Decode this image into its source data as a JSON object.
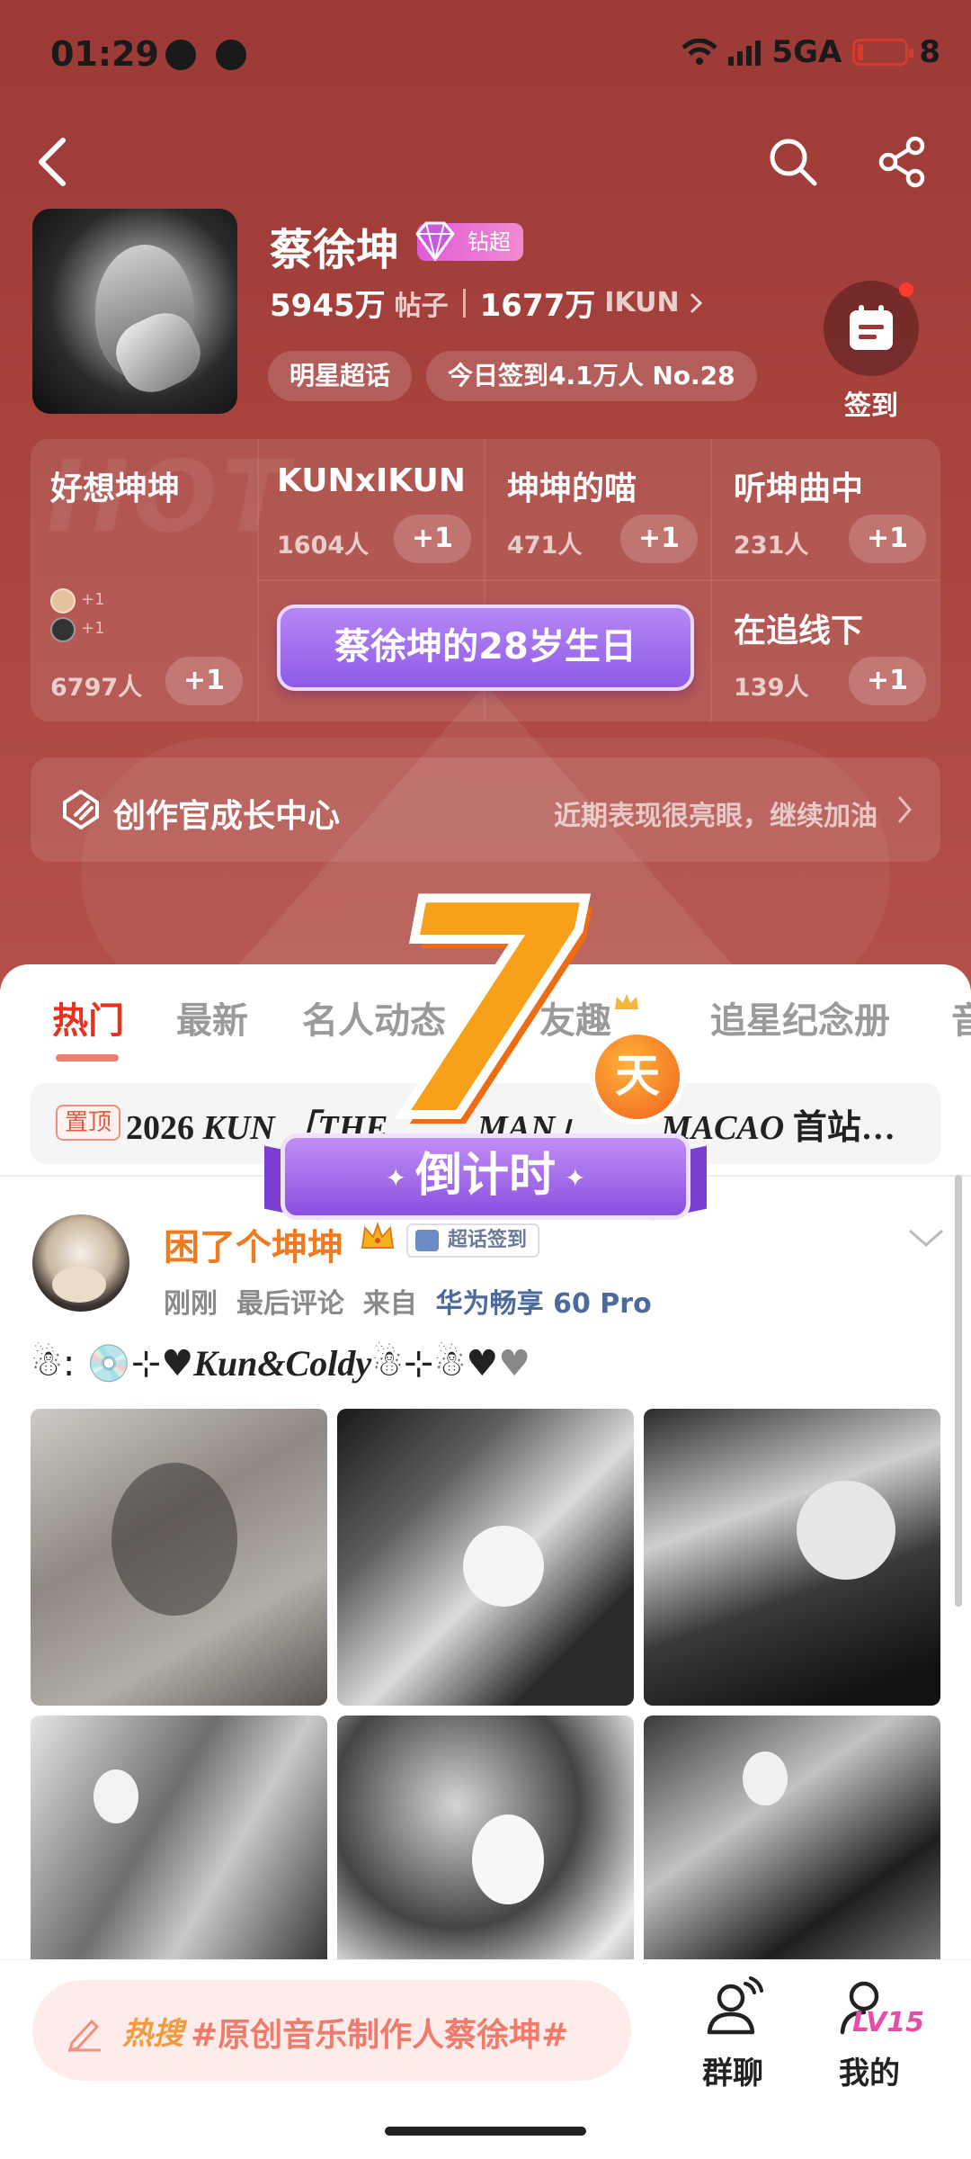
{
  "status_bar": {
    "time": "01:29",
    "network": "5GA",
    "battery": "8"
  },
  "profile": {
    "name": "蔡徐坤",
    "badge": "钻超",
    "posts_count": "5945万",
    "posts_label": "帖子",
    "fans_count": "1677万",
    "fans_label": "IKUN",
    "tags": [
      "明星超话",
      "今日签到4.1万人 No.28"
    ],
    "checkin_label": "签到"
  },
  "groups": [
    {
      "name": "好想坤坤",
      "count": "6797人",
      "join": "+1"
    },
    {
      "name": "KUNxIKUN",
      "count": "1604人",
      "join": "+1"
    },
    {
      "name": "坤坤的喵",
      "count": "471人",
      "join": "+1"
    },
    {
      "name": "听坤曲中",
      "count": "231人",
      "join": "+1"
    },
    {
      "name": "在追线下",
      "count": "139人",
      "join": "+1"
    }
  ],
  "groups_mini": [
    "+1",
    "+1"
  ],
  "birthday_banner": "蔡徐坤的28岁生日",
  "creator": {
    "title": "创作官成长中心",
    "subtitle": "近期表现很亮眼，继续加油"
  },
  "tabs": [
    "热门",
    "最新",
    "名人动态",
    "友趣",
    "追星纪念册",
    "音"
  ],
  "pinned": {
    "tag": "置顶",
    "year": "2026",
    "text_a": "KUN",
    "text_b": "「THE",
    "text_c": "MAN」",
    "text_d": "MACAO",
    "text_e": "首站…"
  },
  "countdown": {
    "number": "7",
    "unit": "天",
    "label": "倒计时"
  },
  "post": {
    "user": "困了个坤坤",
    "signin_badge": "超话签到",
    "time": "刚刚",
    "last_comment": "最后评论",
    "from": "来自",
    "device": "华为畅享 60 Pro",
    "content_script": "Kun&Coldy"
  },
  "bottom_bar": {
    "hot_tag": "热搜",
    "hot_text": "#原创音乐制作人蔡徐坤#",
    "group_chat": "群聊",
    "mine": "我的",
    "level": "LV15"
  },
  "colors": {
    "accent": "#e8321f",
    "hero": "#a8423d",
    "purple": "#9b66ea",
    "orange": "#f7a11a"
  },
  "icons": [
    "back-icon",
    "search-icon",
    "share-icon",
    "calendar-icon",
    "creator-icon",
    "chevron-right-icon",
    "chevron-down-icon",
    "pencil-icon",
    "group-chat-icon",
    "profile-icon",
    "crown-icon",
    "diamond-icon"
  ]
}
